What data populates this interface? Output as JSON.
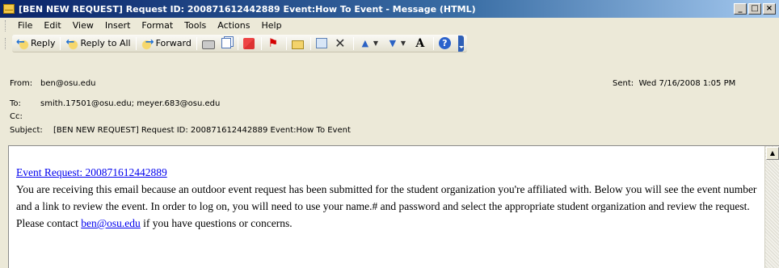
{
  "window": {
    "title": "[BEN NEW REQUEST] Request ID: 200871612442889 Event:How To Event - Message (HTML)",
    "minimize": "_",
    "maximize": "□",
    "close": "×"
  },
  "menu": [
    "File",
    "Edit",
    "View",
    "Insert",
    "Format",
    "Tools",
    "Actions",
    "Help"
  ],
  "toolbar": {
    "reply": "Reply",
    "reply_all": "Reply to All",
    "forward": "Forward",
    "font_glyph": "A",
    "help_glyph": "?"
  },
  "header": {
    "from_label": "From:",
    "from": "ben@osu.edu",
    "to_label": "To:",
    "to": "smith.17501@osu.edu; meyer.683@osu.edu",
    "cc_label": "Cc:",
    "cc": "",
    "subject_label": "Subject:",
    "subject": "[BEN NEW REQUEST] Request ID: 200871612442889 Event:How To Event",
    "sent_label": "Sent:",
    "sent": "Wed 7/16/2008 1:05 PM"
  },
  "body": {
    "link": "Event Request: 200871612442889",
    "text_before": "You are receiving this email because an outdoor event request has been submitted for the student organization you're affiliated with. Below you will see the event number and a link to review the event. In order to log on, you will need to use your name.# and password and select the appropriate student organization and review the request. Please contact ",
    "email_link": "ben@osu.edu",
    "text_after": " if you have questions or concerns."
  }
}
